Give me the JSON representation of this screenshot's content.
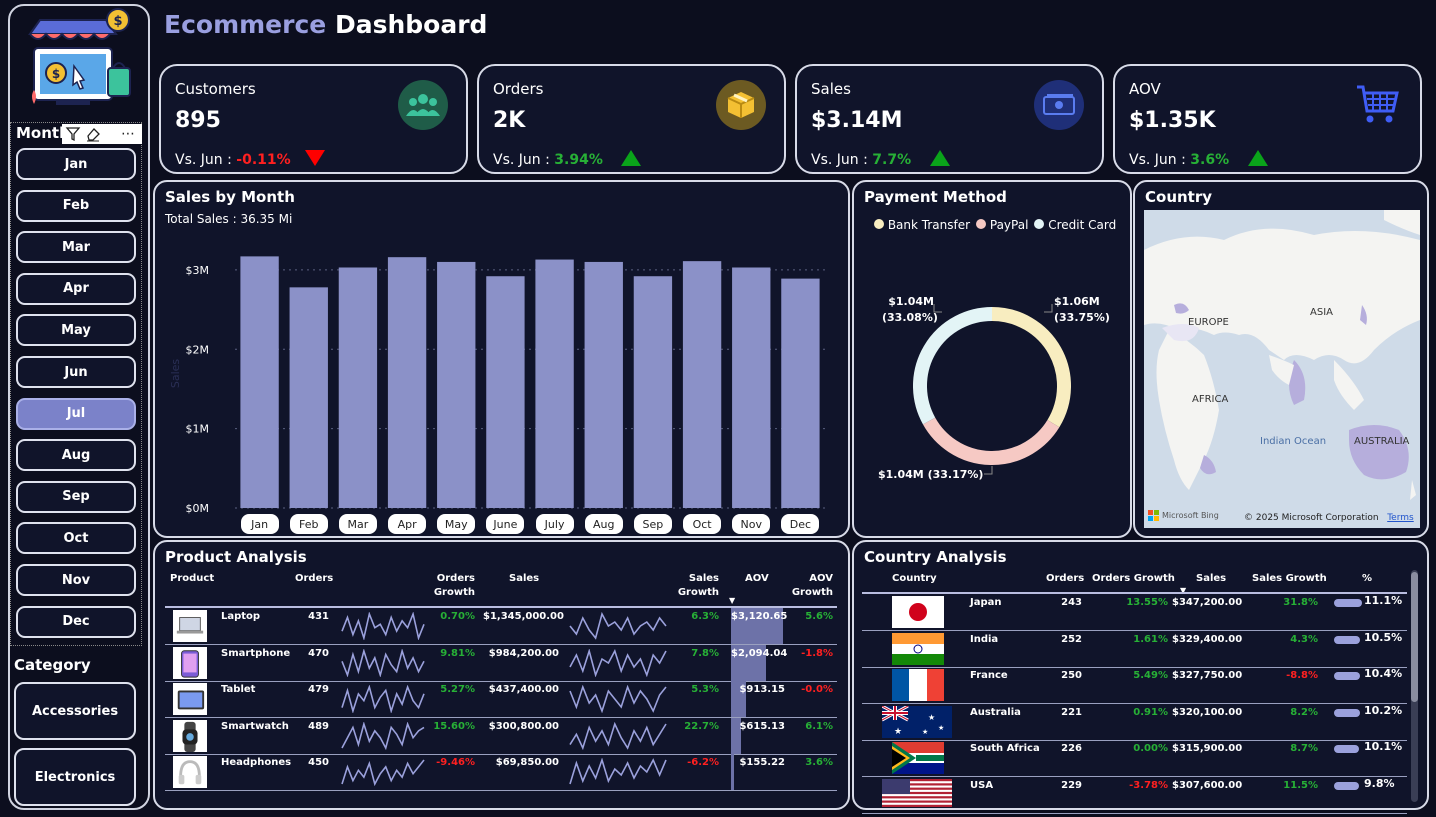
{
  "header": {
    "title_part1": "Ecommerce",
    "title_part2": "Dashboard"
  },
  "colors": {
    "bg": "#0c0e1e",
    "panel": "#10142a",
    "bar": "#8b91c8",
    "positive": "#27b036",
    "negative": "#ff2020",
    "accent": "#7b82c9"
  },
  "sidebar": {
    "month_label": "Month",
    "months": [
      "Jan",
      "Feb",
      "Mar",
      "Apr",
      "May",
      "Jun",
      "Jul",
      "Aug",
      "Sep",
      "Oct",
      "Nov",
      "Dec"
    ],
    "selected_month": "Jul",
    "category_label": "Category",
    "categories": [
      "Accessories",
      "Electronics"
    ],
    "icons": [
      "filter-icon",
      "eraser-icon",
      "more-icon"
    ]
  },
  "kpis": [
    {
      "label": "Customers",
      "value": "895",
      "cmp_prefix": "Vs. Jun :",
      "cmp_value": "-0.11%",
      "direction": "down",
      "icon": "people-icon"
    },
    {
      "label": "Orders",
      "value": "2K",
      "cmp_prefix": "Vs. Jun :",
      "cmp_value": "3.94%",
      "direction": "up",
      "icon": "box-icon"
    },
    {
      "label": "Sales",
      "value": "$3.14M",
      "cmp_prefix": "Vs. Jun :",
      "cmp_value": "7.7%",
      "direction": "up",
      "icon": "money-icon"
    },
    {
      "label": "AOV",
      "value": "$1.35K",
      "cmp_prefix": "Vs. Jun :",
      "cmp_value": "3.6%",
      "direction": "up",
      "icon": "cart-icon"
    }
  ],
  "sales_by_month": {
    "title": "Sales by Month",
    "subtitle": "Total Sales : 36.35 Mi",
    "ylabel": "Sales",
    "yticks": [
      "$0M",
      "$1M",
      "$2M",
      "$3M"
    ]
  },
  "chart_data": {
    "type": "bar",
    "categories": [
      "Jan",
      "Feb",
      "Mar",
      "Apr",
      "May",
      "June",
      "July",
      "Aug",
      "Sep",
      "Oct",
      "Nov",
      "Dec"
    ],
    "values": [
      3.17,
      2.78,
      3.03,
      3.16,
      3.1,
      2.92,
      3.13,
      3.1,
      2.92,
      3.11,
      3.03,
      2.89
    ],
    "ylabel": "Sales",
    "ylim": [
      0,
      3.2
    ],
    "y_unit": "$M",
    "grid": true
  },
  "payment": {
    "title": "Payment Method",
    "legend": [
      {
        "name": "Bank Transfer",
        "color": "#f8edc0"
      },
      {
        "name": "PayPal",
        "color": "#f6c9c4"
      },
      {
        "name": "Credit Card",
        "color": "#e3f4f6"
      }
    ],
    "slices": [
      {
        "name": "Bank Transfer",
        "share": 33.75,
        "label1": "$1.06M",
        "label2": "(33.75%)"
      },
      {
        "name": "PayPal",
        "share": 33.17,
        "label1": "$1.04M (33.17%)",
        "label2": ""
      },
      {
        "name": "Credit Card",
        "share": 33.08,
        "label1": "$1.04M",
        "label2": "(33.08%)"
      }
    ]
  },
  "country_map": {
    "title": "Country",
    "labels": {
      "europe": "EUROPE",
      "asia": "ASIA",
      "africa": "AFRICA",
      "ocean": "Indian Ocean",
      "australia": "AUSTRALIA"
    },
    "attribution": "Microsoft Bing",
    "copyright": "© 2025 Microsoft Corporation",
    "terms": "Terms"
  },
  "product_analysis": {
    "title": "Product Analysis",
    "headers": {
      "product": "Product",
      "orders": "Orders",
      "orders_growth": "Orders Growth",
      "sales": "Sales",
      "sales_growth": "Sales Growth",
      "aov": "AOV",
      "aov_growth": "AOV Growth"
    },
    "rows": [
      {
        "name": "Laptop",
        "orders": "431",
        "orders_growth": "0.70%",
        "og_dir": "pos",
        "sales": "$1,345,000.00",
        "sales_growth": "6.3%",
        "sg_dir": "pos",
        "aov": "$3,120.65",
        "aov_share": 1.0,
        "aov_growth": "5.6%",
        "ag_dir": "pos",
        "icon": "laptop-icon",
        "spark1": [
          5,
          9,
          4,
          8,
          3,
          10,
          6,
          7,
          4,
          9,
          5,
          8,
          6,
          10,
          3,
          7
        ],
        "spark2": [
          6,
          4,
          8,
          5,
          3,
          9,
          6,
          7,
          5,
          8,
          4,
          6,
          7,
          5,
          8,
          6
        ]
      },
      {
        "name": "Smartphone",
        "orders": "470",
        "orders_growth": "9.81%",
        "og_dir": "pos",
        "sales": "$984,200.00",
        "sales_growth": "7.8%",
        "sg_dir": "pos",
        "aov": "$2,094.04",
        "aov_share": 0.67,
        "aov_growth": "-1.8%",
        "ag_dir": "neg",
        "icon": "smartphone-icon",
        "spark1": [
          7,
          3,
          9,
          4,
          10,
          5,
          8,
          3,
          9,
          6,
          4,
          10,
          5,
          8,
          4,
          7
        ],
        "spark2": [
          5,
          8,
          4,
          9,
          3,
          7,
          6,
          9,
          4,
          8,
          5,
          7,
          3,
          8,
          6,
          9
        ]
      },
      {
        "name": "Tablet",
        "orders": "479",
        "orders_growth": "5.27%",
        "og_dir": "pos",
        "sales": "$437,400.00",
        "sales_growth": "5.3%",
        "sg_dir": "pos",
        "aov": "$913.15",
        "aov_share": 0.29,
        "aov_growth": "-0.0%",
        "ag_dir": "neg",
        "icon": "tablet-icon",
        "spark1": [
          4,
          9,
          3,
          8,
          6,
          10,
          4,
          7,
          9,
          3,
          8,
          5,
          10,
          6,
          4,
          8
        ],
        "spark2": [
          8,
          4,
          9,
          5,
          7,
          3,
          8,
          6,
          4,
          9,
          5,
          8,
          6,
          3,
          7,
          9
        ]
      },
      {
        "name": "Smartwatch",
        "orders": "489",
        "orders_growth": "15.60%",
        "og_dir": "pos",
        "sales": "$300,800.00",
        "sales_growth": "22.7%",
        "sg_dir": "pos",
        "aov": "$615.13",
        "aov_share": 0.2,
        "aov_growth": "6.1%",
        "ag_dir": "pos",
        "icon": "smartwatch-icon",
        "spark1": [
          3,
          6,
          9,
          4,
          10,
          5,
          8,
          6,
          3,
          9,
          7,
          4,
          10,
          6,
          8,
          9
        ],
        "spark2": [
          4,
          7,
          3,
          9,
          5,
          8,
          4,
          10,
          6,
          3,
          8,
          5,
          9,
          4,
          7,
          10
        ]
      },
      {
        "name": "Headphones",
        "orders": "450",
        "orders_growth": "-9.46%",
        "og_dir": "neg",
        "sales": "$69,850.00",
        "sales_growth": "-6.2%",
        "sg_dir": "neg",
        "aov": "$155.22",
        "aov_share": 0.05,
        "aov_growth": "3.6%",
        "ag_dir": "pos",
        "icon": "headphones-icon",
        "spark1": [
          3,
          8,
          4,
          7,
          5,
          9,
          3,
          6,
          8,
          4,
          7,
          5,
          9,
          6,
          8,
          10
        ],
        "spark2": [
          2,
          9,
          3,
          8,
          4,
          10,
          3,
          7,
          5,
          9,
          4,
          8,
          6,
          10,
          5,
          10
        ]
      }
    ]
  },
  "country_analysis": {
    "title": "Country Analysis",
    "headers": {
      "country": "Country",
      "orders": "Orders",
      "orders_growth": "Orders Growth",
      "sales": "Sales",
      "sales_growth": "Sales Growth",
      "pct": "%"
    },
    "rows": [
      {
        "name": "Japan",
        "orders": "243",
        "orders_growth": "13.55%",
        "og_dir": "pos",
        "sales": "$347,200.00",
        "sales_growth": "31.8%",
        "sg_dir": "pos",
        "pct": "11.1%",
        "share": 11.1,
        "flag": "japan-flag-icon"
      },
      {
        "name": "India",
        "orders": "252",
        "orders_growth": "1.61%",
        "og_dir": "pos",
        "sales": "$329,400.00",
        "sales_growth": "4.3%",
        "sg_dir": "pos",
        "pct": "10.5%",
        "share": 10.5,
        "flag": "india-flag-icon"
      },
      {
        "name": "France",
        "orders": "250",
        "orders_growth": "5.49%",
        "og_dir": "pos",
        "sales": "$327,750.00",
        "sales_growth": "-8.8%",
        "sg_dir": "neg",
        "pct": "10.4%",
        "share": 10.4,
        "flag": "france-flag-icon"
      },
      {
        "name": "Australia",
        "orders": "221",
        "orders_growth": "0.91%",
        "og_dir": "pos",
        "sales": "$320,100.00",
        "sales_growth": "8.2%",
        "sg_dir": "pos",
        "pct": "10.2%",
        "share": 10.2,
        "flag": "australia-flag-icon"
      },
      {
        "name": "South Africa",
        "orders": "226",
        "orders_growth": "0.00%",
        "og_dir": "pos",
        "sales": "$315,900.00",
        "sales_growth": "8.7%",
        "sg_dir": "pos",
        "pct": "10.1%",
        "share": 10.1,
        "flag": "south-africa-flag-icon"
      },
      {
        "name": "USA",
        "orders": "229",
        "orders_growth": "-3.78%",
        "og_dir": "neg",
        "sales": "$307,600.00",
        "sales_growth": "11.5%",
        "sg_dir": "pos",
        "pct": "9.8%",
        "share": 9.8,
        "flag": "usa-flag-icon"
      }
    ]
  }
}
